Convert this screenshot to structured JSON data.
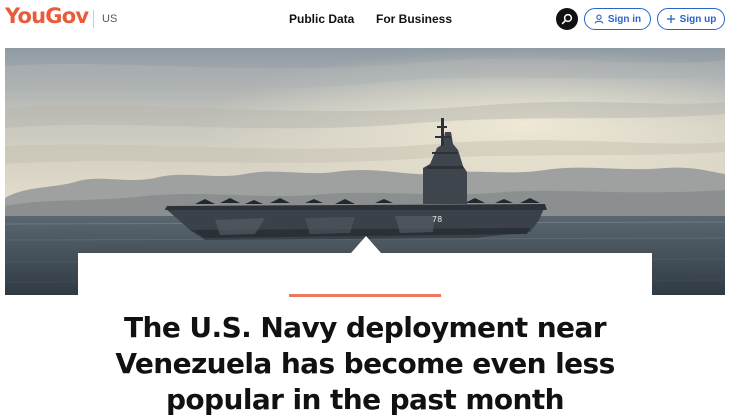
{
  "header": {
    "logo_text": "YouGov",
    "region": "US",
    "nav": [
      {
        "label": "Public Data"
      },
      {
        "label": "For Business"
      }
    ],
    "search_icon": "search-icon",
    "sign_in_label": "Sign in",
    "sign_up_label": "Sign up"
  },
  "hero": {
    "image": "aircraft-carrier-at-sea"
  },
  "article": {
    "headline": "The U.S. Navy deployment near Venezuela has become even less popular in the past month"
  },
  "colors": {
    "brand": "#ea5b3a",
    "accent_rule": "#ea7a5e",
    "link_blue": "#2b63c9"
  }
}
